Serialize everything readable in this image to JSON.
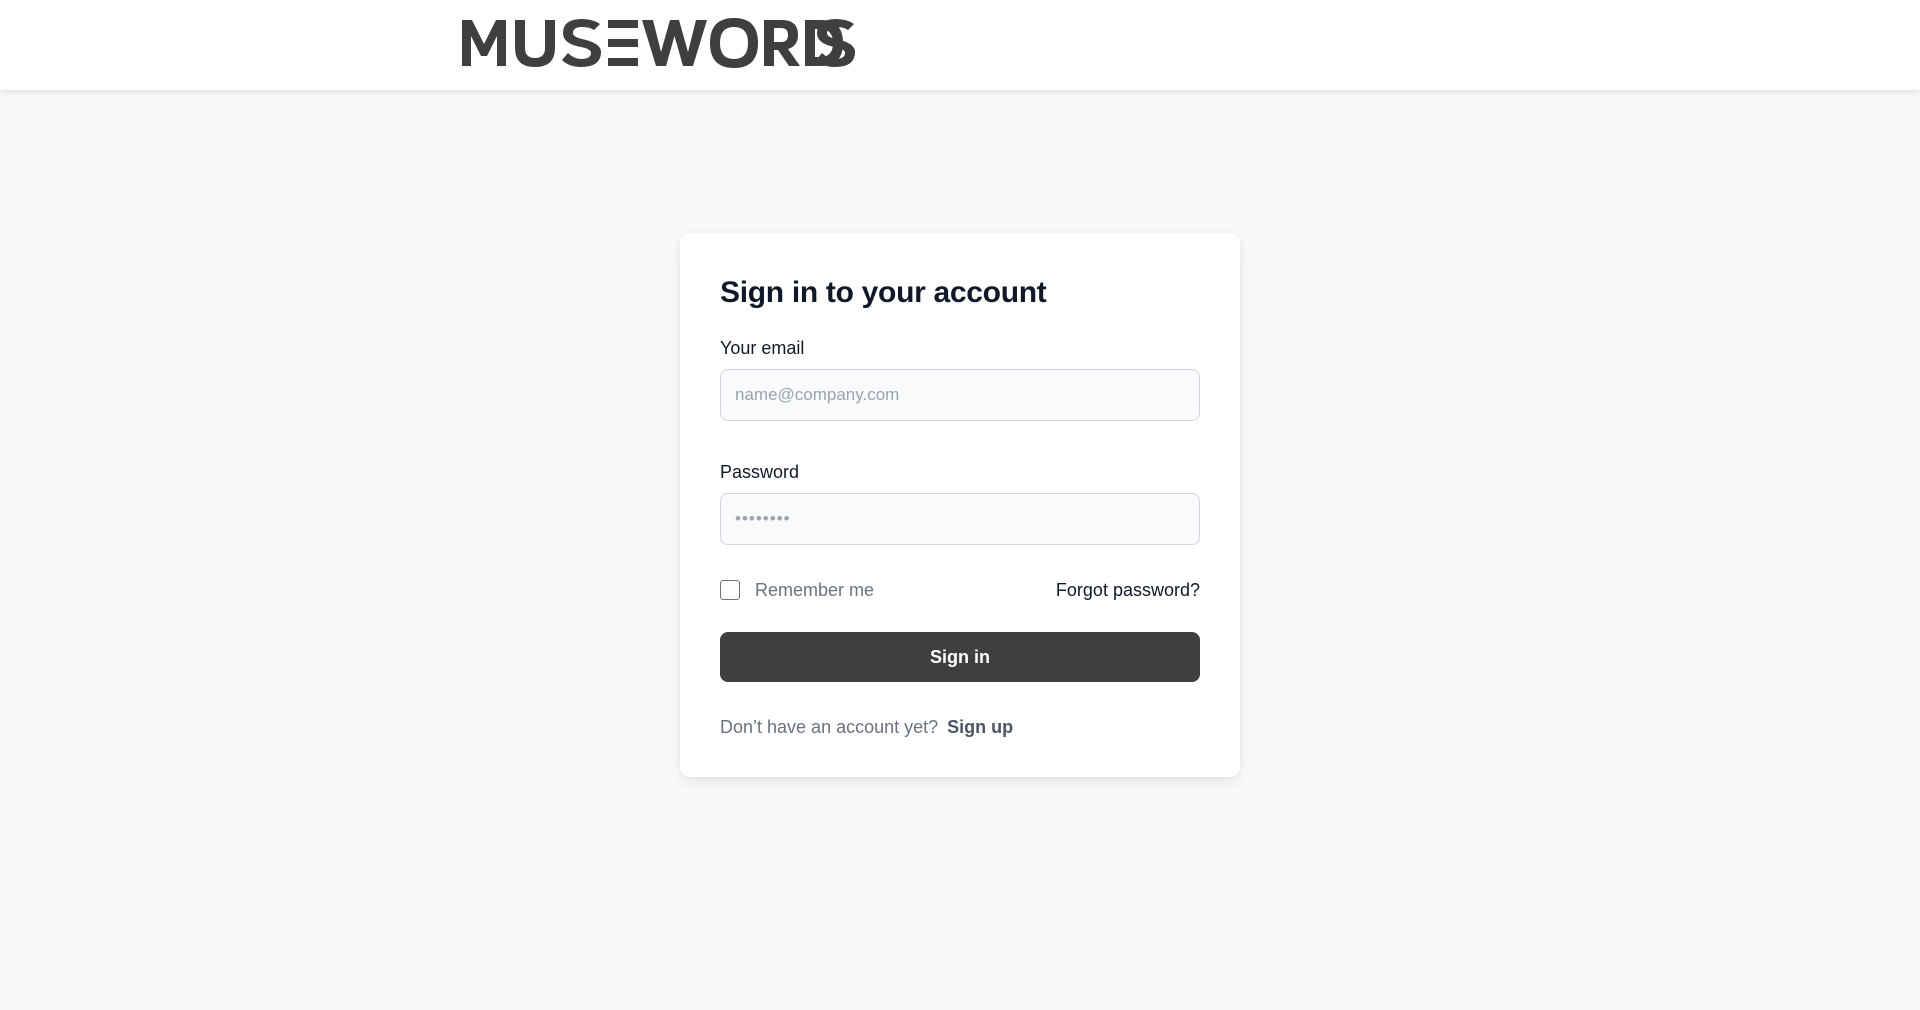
{
  "header": {
    "logo_text": "MUSEWORDS"
  },
  "login": {
    "title": "Sign in to your account",
    "email_label": "Your email",
    "email_placeholder": "name@company.com",
    "email_value": "",
    "password_label": "Password",
    "password_placeholder": "••••••••",
    "password_value": "",
    "remember_label": "Remember me",
    "remember_checked": false,
    "forgot_label": "Forgot password?",
    "submit_label": "Sign in",
    "signup_prompt": "Don’t have an account yet?",
    "signup_label": "Sign up"
  },
  "colors": {
    "page_background": "#f8f9fa",
    "card_background": "#ffffff",
    "primary_button": "#3f3f3f",
    "logo": "#3f3f3f",
    "heading_text": "#111827",
    "muted_text": "#6b7280"
  }
}
